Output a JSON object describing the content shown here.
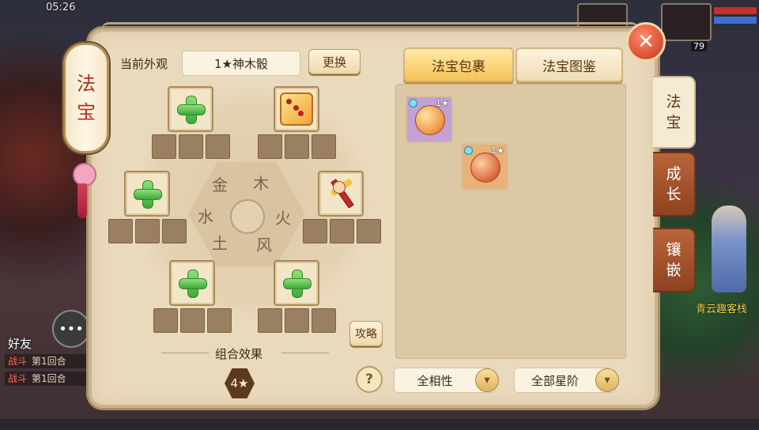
{
  "status": {
    "time": "05:26",
    "player_level": "79"
  },
  "scroll_title": [
    "法",
    "宝"
  ],
  "header": {
    "current_label": "当前外观",
    "current_value": "1★神木骰",
    "change_button": "更换"
  },
  "elements": [
    "金",
    "木",
    "火",
    "土",
    "水",
    "风"
  ],
  "slots": [
    {
      "state": "empty"
    },
    {
      "state": "dice"
    },
    {
      "state": "empty"
    },
    {
      "state": "sword"
    },
    {
      "state": "empty"
    },
    {
      "state": "empty"
    }
  ],
  "strategy_button": "攻略",
  "combo": {
    "title": "组合效果",
    "stars": "4★"
  },
  "tabs": {
    "bag": "法宝包裹",
    "catalog": "法宝图鉴"
  },
  "inventory": [
    {
      "stars": "1★"
    },
    {
      "stars": "1★"
    }
  ],
  "filters": {
    "help": "?",
    "affinity": "全相性",
    "star_tier": "全部星阶"
  },
  "side_tabs": [
    {
      "label": [
        "法",
        "宝"
      ]
    },
    {
      "label": [
        "成",
        "长"
      ]
    },
    {
      "label": [
        "镶",
        "嵌"
      ]
    }
  ],
  "close_label": "✕",
  "chat": {
    "friend_label": "好友",
    "lines": [
      {
        "tag": "战斗",
        "text": "第1回合"
      },
      {
        "tag": "战斗",
        "text": "第1回合"
      }
    ]
  },
  "npc_name": "青云趣客栈",
  "colors": {
    "panel": "#e9d9bd",
    "tab_active": "#f5c457",
    "accent_red": "#c8321c",
    "plus_green": "#3fa83a"
  }
}
